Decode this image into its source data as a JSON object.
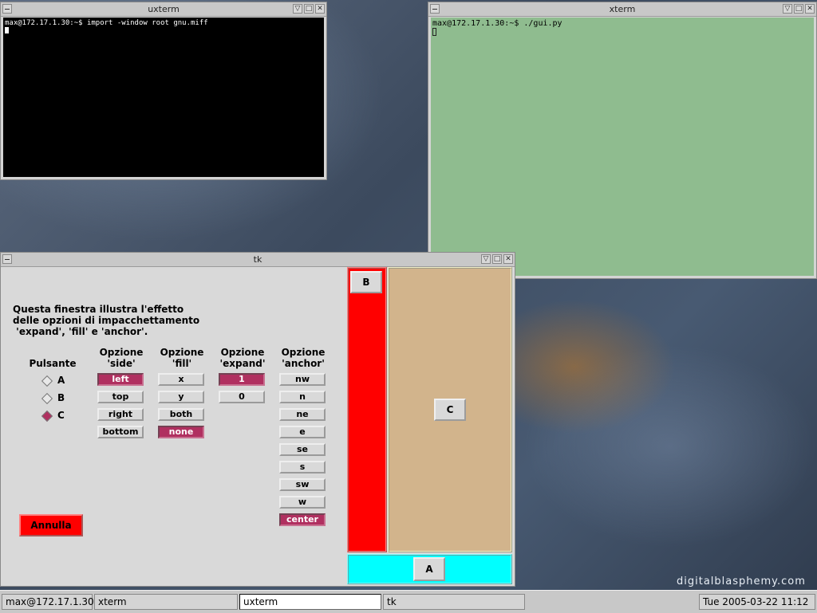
{
  "desktop": {
    "watermark": "digitalblasphemy.com"
  },
  "uxterm": {
    "title": "uxterm",
    "line": "max@172.17.1.30:~$ import -window root gnu.miff"
  },
  "xterm": {
    "title": "xterm",
    "line": "max@172.17.1.30:~$ ./gui.py"
  },
  "tk": {
    "title": "tk",
    "intro": [
      "Questa finestra illustra l'effetto",
      "delle opzioni di impacchettamento",
      " 'expand', 'fill' e 'anchor'."
    ],
    "pulsante_header": "Pulsante",
    "radios": [
      {
        "label": "A",
        "selected": false
      },
      {
        "label": "B",
        "selected": false
      },
      {
        "label": "C",
        "selected": true
      }
    ],
    "columns": [
      {
        "head1": "Opzione",
        "head2": "'side'",
        "options": [
          {
            "label": "left",
            "selected": true
          },
          {
            "label": "top",
            "selected": false
          },
          {
            "label": "right",
            "selected": false
          },
          {
            "label": "bottom",
            "selected": false
          }
        ]
      },
      {
        "head1": "Opzione",
        "head2": "'fill'",
        "options": [
          {
            "label": "x",
            "selected": false
          },
          {
            "label": "y",
            "selected": false
          },
          {
            "label": "both",
            "selected": false
          },
          {
            "label": "none",
            "selected": true
          }
        ]
      },
      {
        "head1": "Opzione",
        "head2": "'expand'",
        "options": [
          {
            "label": "1",
            "selected": true
          },
          {
            "label": "0",
            "selected": false
          }
        ]
      },
      {
        "head1": "Opzione",
        "head2": "'anchor'",
        "options": [
          {
            "label": "nw",
            "selected": false
          },
          {
            "label": "n",
            "selected": false
          },
          {
            "label": "ne",
            "selected": false
          },
          {
            "label": "e",
            "selected": false
          },
          {
            "label": "se",
            "selected": false
          },
          {
            "label": "s",
            "selected": false
          },
          {
            "label": "sw",
            "selected": false
          },
          {
            "label": "w",
            "selected": false
          },
          {
            "label": "center",
            "selected": true
          }
        ]
      }
    ],
    "cancel_label": "Annulla",
    "demo": {
      "a_label": "A",
      "b_label": "B",
      "c_label": "C"
    },
    "colors": {
      "selected": "#b03060",
      "red_frame": "#ff0000",
      "tan_frame": "#d2b48c",
      "cyan_frame": "#00ffff"
    }
  },
  "taskbar": {
    "items": [
      "max@172.17.1.30",
      "xterm",
      "uxterm",
      "tk"
    ],
    "clock": "Tue 2005-03-22 11:12"
  }
}
